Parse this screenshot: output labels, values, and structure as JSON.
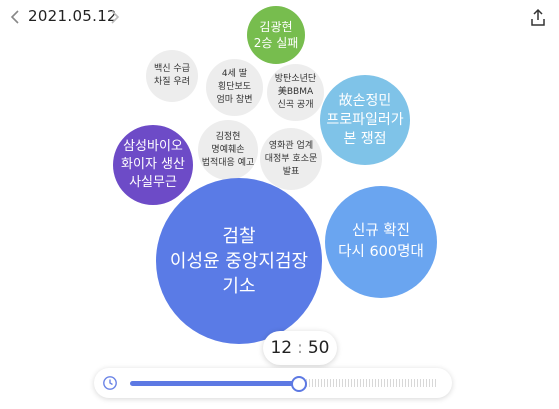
{
  "header": {
    "date": "2021.05.12",
    "prev_icon": "chevron-left-icon",
    "next_icon": "chevron-right-icon",
    "share_icon": "share-icon"
  },
  "bubbles": [
    {
      "id": "kim-kwanghyun",
      "label": "김광현\n2승 실패",
      "color": "#77bd4e"
    },
    {
      "id": "vaccine",
      "label": "백신 수급\n차질 우려",
      "color": "#ededed"
    },
    {
      "id": "four-year-old",
      "label": "4세 딸\n횡단보도\n엄마 참변",
      "color": "#ededed"
    },
    {
      "id": "bts",
      "label": "방탄소년단\n美BBMA\n신곡 공개",
      "color": "#ededed"
    },
    {
      "id": "son-jungmin",
      "label": "故손정민\n프로파일러가\n본 쟁점",
      "color": "#7fc3e8"
    },
    {
      "id": "samsung-bio",
      "label": "삼성바이오\n화이자 생산\n사실무근",
      "color": "#6d4bc7"
    },
    {
      "id": "kim-junghyun",
      "label": "김정현\n명예훼손\n법적대응 예고",
      "color": "#ededed"
    },
    {
      "id": "cinema",
      "label": "영화관 업계\n대정부 호소문\n발표",
      "color": "#ededed"
    },
    {
      "id": "prosecution",
      "label": "검찰\n이성윤 중앙지검장\n기소",
      "color": "#5a7be6"
    },
    {
      "id": "new-cases",
      "label": "신규 확진\n다시 600명대",
      "color": "#6aa5f0"
    }
  ],
  "timeline": {
    "hour": "12",
    "minute": "50",
    "progress": 0.55,
    "clock_icon": "clock-icon"
  }
}
